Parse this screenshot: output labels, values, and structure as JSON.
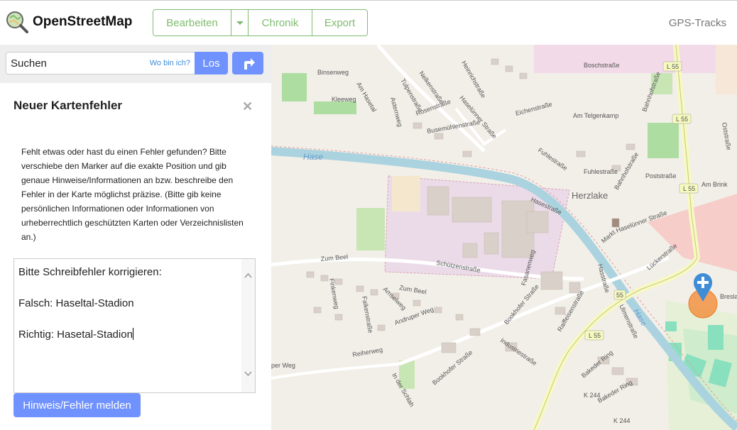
{
  "header": {
    "brand": "OpenStreetMap",
    "edit_label": "Bearbeiten",
    "history_label": "Chronik",
    "export_label": "Export",
    "gps_label": "GPS-Tracks",
    "icons": {
      "logo": "osm-magnifier-logo-icon",
      "caret": "caret-down-icon"
    }
  },
  "search": {
    "value": "Suchen",
    "where_label": "Wo bin ich?",
    "go_label": "Los",
    "directions_icon": "directions-arrow-icon"
  },
  "panel": {
    "title": "Neuer Kartenfehler",
    "close_icon": "close-icon",
    "description": "Fehlt etwas oder hast du einen Fehler gefunden? Bitte verschiebe den Marker auf die exakte Position und gib genaue Hinweise/Informationen an bzw. beschreibe den Fehler in der Karte möglichst präzise. (Bitte gib keine persönlichen Informationen oder Informationen von urheberrechtlich geschützten Karten oder Verzeichnislisten an.)",
    "note_text": "Bitte Schreibfehler korrigieren:\n\nFalsch: Haseltal-Stadion\n\nRichtig: Hasetal-Stadion",
    "submit_label": "Hinweis/Fehler melden"
  },
  "map": {
    "labels": {
      "binsenweg": "Binsenweg",
      "am_hasetal": "Am Hasetal",
      "kleeweg": "Kleeweg",
      "tulpenstrasse": "Tulpenstraße",
      "nelkenstrasse": "Nelkenstraße",
      "asternweg": "Asternweg",
      "rosenstrasse": "Rosenstraße",
      "heinrichstrasse": "Heinrichstraße",
      "haseluenner_strasse": "Haselünner Straße",
      "busemuehlenstrasse": "Busemühlenstraße",
      "boschstrasse": "Boschstraße",
      "l55_a": "L 55",
      "l55_b": "L 55",
      "l55_c": "L 55",
      "l55_d": "L 55",
      "bahnhofstrasse": "Bahnhofstraße",
      "eichenstrasse": "Eichenstraße",
      "am_telgenkamp": "Am Telgenkamp",
      "oststrasse": "Oststraße",
      "hase_1": "Hase",
      "hase_2": "Hase",
      "fuhlestrasse_1": "Fuhlestraße",
      "fuhlestrasse_2": "Fuhlestraße",
      "bahnhofstrasse_2": "Bahnhofstraße",
      "poststrasse": "Poststraße",
      "am_brink": "Am Brink",
      "herzlake": "Herzlake",
      "hasestrasse": "Hasestraße",
      "markt": "Markt",
      "haseluenner_strasse_2": "Haselünner Straße",
      "zum_beel_1": "Zum Beel",
      "zum_beel_2": "Zum Beel",
      "schuetzenstrasse": "Schützenstraße",
      "fasanenweg": "Fasanenweg",
      "finkenweg": "Finkenweg",
      "falkenstrasse": "Falkenstraße",
      "amselweg": "Amselweg",
      "andruper_weg": "Andruper Weg",
      "bookhofer_strasse": "Bookhofer Straße",
      "raiffeisenstrasse": "Raiffeisenstraße",
      "hasstrasse": "Hasstraße",
      "s55": "55",
      "l55_e": "L 55",
      "ulmenstrasse": "Ulmenstraße",
      "industriestrasse": "Industriestraße",
      "reiherweg": "Reiherweg",
      "per_weg": "per Weg",
      "in_der_schlah": "In der Schlah",
      "bookhofer_strasse_2": "Bookhofer Straße",
      "bakeder_ring_1": "Bakeder Ring",
      "bakeder_ring_2": "Bakeder Ring",
      "k244_a": "K 244",
      "k244_b": "K 244",
      "lueckerstrasse": "Lückerstraße",
      "hase_3": "Hase",
      "bresla": "Bresla"
    },
    "marker_icon": "plus-marker-icon"
  }
}
